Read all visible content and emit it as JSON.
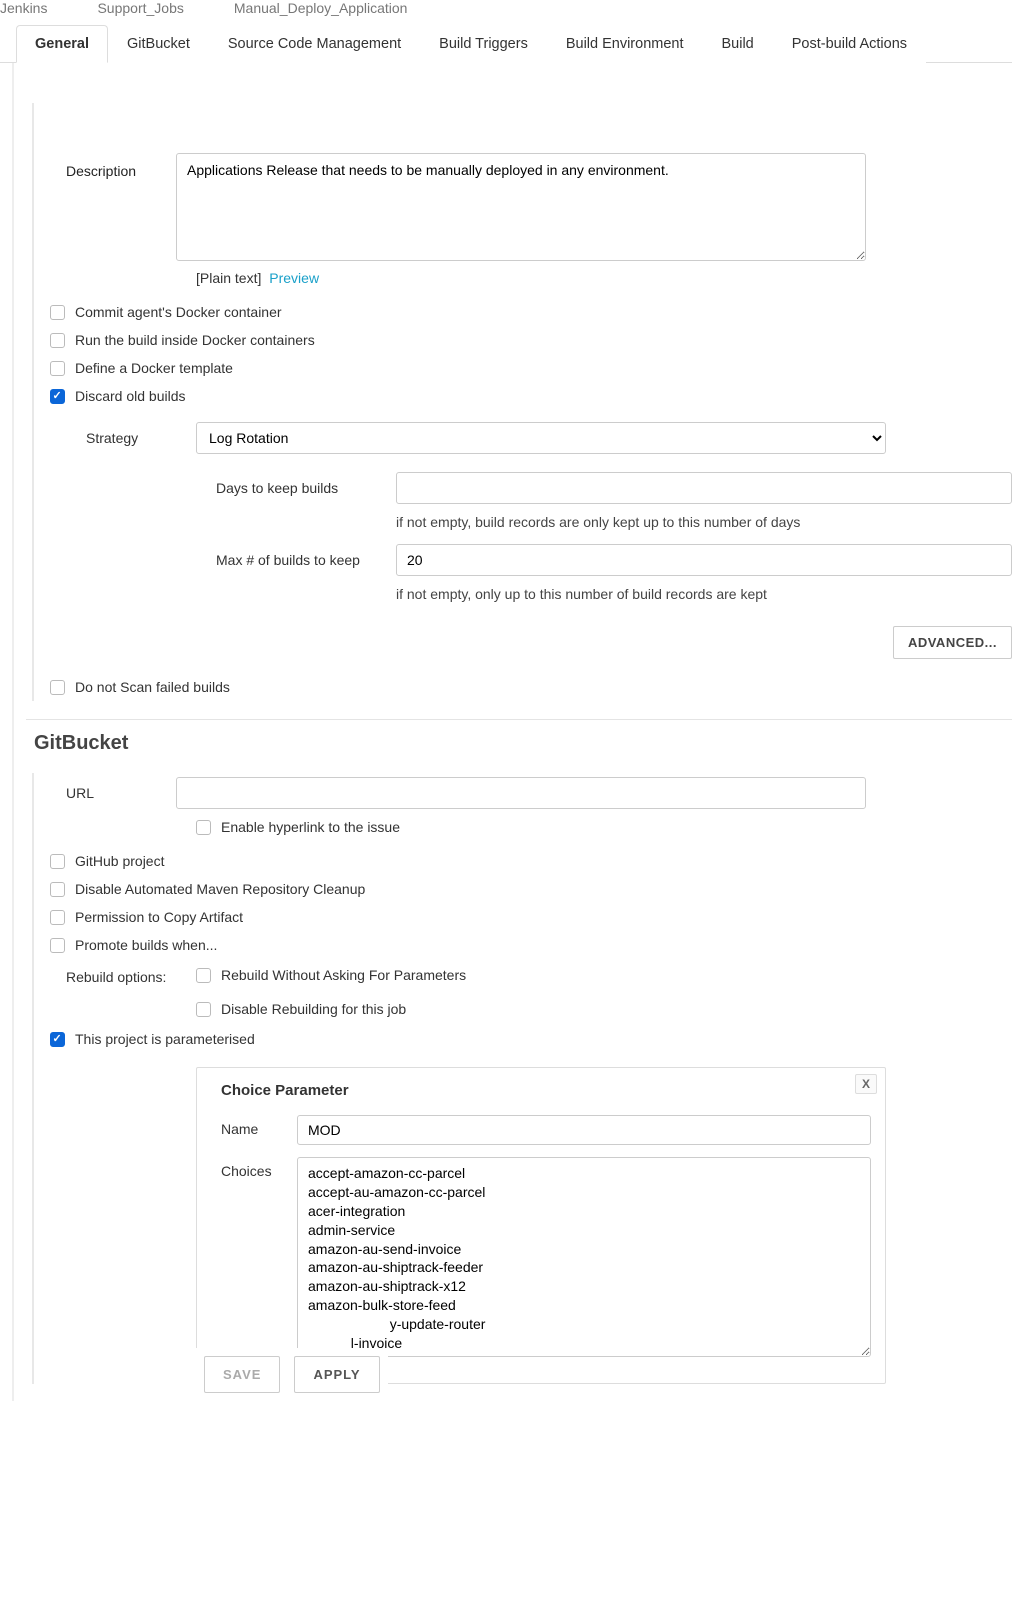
{
  "breadcrumb": [
    "Jenkins",
    "Support_Jobs",
    "Manual_Deploy_Application"
  ],
  "tabs": [
    {
      "label": "General",
      "active": true
    },
    {
      "label": "GitBucket",
      "active": false
    },
    {
      "label": "Source Code Management",
      "active": false
    },
    {
      "label": "Build Triggers",
      "active": false
    },
    {
      "label": "Build Environment",
      "active": false
    },
    {
      "label": "Build",
      "active": false
    },
    {
      "label": "Post-build Actions",
      "active": false
    }
  ],
  "description": {
    "label": "Description",
    "value": "Applications Release that needs to be manually deployed in any environment.",
    "plain_text": "[Plain text]",
    "preview": "Preview"
  },
  "checks": {
    "commit_docker": {
      "label": "Commit agent's Docker container",
      "checked": false
    },
    "run_inside_docker": {
      "label": "Run the build inside Docker containers",
      "checked": false
    },
    "define_docker_template": {
      "label": "Define a Docker template",
      "checked": false
    },
    "discard_old": {
      "label": "Discard old builds",
      "checked": true
    },
    "do_not_scan": {
      "label": "Do not Scan failed builds",
      "checked": false
    }
  },
  "strategy": {
    "label": "Strategy",
    "value": "Log Rotation",
    "days": {
      "label": "Days to keep builds",
      "value": "",
      "hint": "if not empty, build records are only kept up to this number of days"
    },
    "max": {
      "label": "Max # of builds to keep",
      "value": "20",
      "hint": "if not empty, only up to this number of build records are kept"
    },
    "advanced": "ADVANCED..."
  },
  "gitbucket": {
    "title": "GitBucket",
    "url_label": "URL",
    "url_value": "",
    "enable_hyperlink": {
      "label": "Enable hyperlink to the issue",
      "checked": false
    }
  },
  "post_checks": {
    "github_project": {
      "label": "GitHub project",
      "checked": false
    },
    "disable_maven_cleanup": {
      "label": "Disable Automated Maven Repository Cleanup",
      "checked": false
    },
    "permission_copy": {
      "label": "Permission to Copy Artifact",
      "checked": false
    },
    "promote_when": {
      "label": "Promote builds when...",
      "checked": false
    }
  },
  "rebuild": {
    "label": "Rebuild options:",
    "without_asking": {
      "label": "Rebuild Without Asking For Parameters",
      "checked": false
    },
    "disable_rebuild": {
      "label": "Disable Rebuilding for this job",
      "checked": false
    }
  },
  "parameterised": {
    "label": "This project is parameterised",
    "checked": true
  },
  "param_box": {
    "title": "Choice Parameter",
    "close": "X",
    "name_label": "Name",
    "name_value": "MOD",
    "choices_label": "Choices",
    "choices_value": "accept-amazon-cc-parcel\naccept-au-amazon-cc-parcel\nacer-integration\nadmin-service\namazon-au-send-invoice\namazon-au-shiptrack-feeder\namazon-au-shiptrack-x12\namazon-bulk-store-feed\n                     y-update-router\n           l-invoice\n            rack-feeder"
  },
  "buttons": {
    "save": "SAVE",
    "apply": "APPLY"
  }
}
